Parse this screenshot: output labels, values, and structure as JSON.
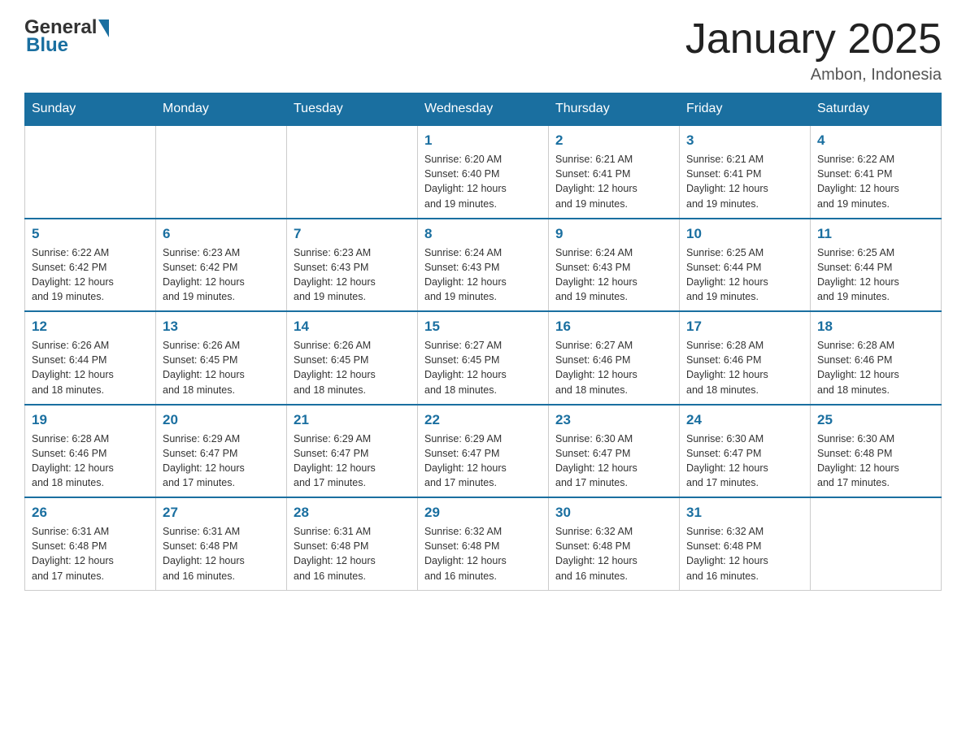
{
  "header": {
    "logo_general": "General",
    "logo_blue": "Blue",
    "month_title": "January 2025",
    "location": "Ambon, Indonesia"
  },
  "days_of_week": [
    "Sunday",
    "Monday",
    "Tuesday",
    "Wednesday",
    "Thursday",
    "Friday",
    "Saturday"
  ],
  "weeks": [
    [
      {
        "day": "",
        "info": ""
      },
      {
        "day": "",
        "info": ""
      },
      {
        "day": "",
        "info": ""
      },
      {
        "day": "1",
        "info": "Sunrise: 6:20 AM\nSunset: 6:40 PM\nDaylight: 12 hours\nand 19 minutes."
      },
      {
        "day": "2",
        "info": "Sunrise: 6:21 AM\nSunset: 6:41 PM\nDaylight: 12 hours\nand 19 minutes."
      },
      {
        "day": "3",
        "info": "Sunrise: 6:21 AM\nSunset: 6:41 PM\nDaylight: 12 hours\nand 19 minutes."
      },
      {
        "day": "4",
        "info": "Sunrise: 6:22 AM\nSunset: 6:41 PM\nDaylight: 12 hours\nand 19 minutes."
      }
    ],
    [
      {
        "day": "5",
        "info": "Sunrise: 6:22 AM\nSunset: 6:42 PM\nDaylight: 12 hours\nand 19 minutes."
      },
      {
        "day": "6",
        "info": "Sunrise: 6:23 AM\nSunset: 6:42 PM\nDaylight: 12 hours\nand 19 minutes."
      },
      {
        "day": "7",
        "info": "Sunrise: 6:23 AM\nSunset: 6:43 PM\nDaylight: 12 hours\nand 19 minutes."
      },
      {
        "day": "8",
        "info": "Sunrise: 6:24 AM\nSunset: 6:43 PM\nDaylight: 12 hours\nand 19 minutes."
      },
      {
        "day": "9",
        "info": "Sunrise: 6:24 AM\nSunset: 6:43 PM\nDaylight: 12 hours\nand 19 minutes."
      },
      {
        "day": "10",
        "info": "Sunrise: 6:25 AM\nSunset: 6:44 PM\nDaylight: 12 hours\nand 19 minutes."
      },
      {
        "day": "11",
        "info": "Sunrise: 6:25 AM\nSunset: 6:44 PM\nDaylight: 12 hours\nand 19 minutes."
      }
    ],
    [
      {
        "day": "12",
        "info": "Sunrise: 6:26 AM\nSunset: 6:44 PM\nDaylight: 12 hours\nand 18 minutes."
      },
      {
        "day": "13",
        "info": "Sunrise: 6:26 AM\nSunset: 6:45 PM\nDaylight: 12 hours\nand 18 minutes."
      },
      {
        "day": "14",
        "info": "Sunrise: 6:26 AM\nSunset: 6:45 PM\nDaylight: 12 hours\nand 18 minutes."
      },
      {
        "day": "15",
        "info": "Sunrise: 6:27 AM\nSunset: 6:45 PM\nDaylight: 12 hours\nand 18 minutes."
      },
      {
        "day": "16",
        "info": "Sunrise: 6:27 AM\nSunset: 6:46 PM\nDaylight: 12 hours\nand 18 minutes."
      },
      {
        "day": "17",
        "info": "Sunrise: 6:28 AM\nSunset: 6:46 PM\nDaylight: 12 hours\nand 18 minutes."
      },
      {
        "day": "18",
        "info": "Sunrise: 6:28 AM\nSunset: 6:46 PM\nDaylight: 12 hours\nand 18 minutes."
      }
    ],
    [
      {
        "day": "19",
        "info": "Sunrise: 6:28 AM\nSunset: 6:46 PM\nDaylight: 12 hours\nand 18 minutes."
      },
      {
        "day": "20",
        "info": "Sunrise: 6:29 AM\nSunset: 6:47 PM\nDaylight: 12 hours\nand 17 minutes."
      },
      {
        "day": "21",
        "info": "Sunrise: 6:29 AM\nSunset: 6:47 PM\nDaylight: 12 hours\nand 17 minutes."
      },
      {
        "day": "22",
        "info": "Sunrise: 6:29 AM\nSunset: 6:47 PM\nDaylight: 12 hours\nand 17 minutes."
      },
      {
        "day": "23",
        "info": "Sunrise: 6:30 AM\nSunset: 6:47 PM\nDaylight: 12 hours\nand 17 minutes."
      },
      {
        "day": "24",
        "info": "Sunrise: 6:30 AM\nSunset: 6:47 PM\nDaylight: 12 hours\nand 17 minutes."
      },
      {
        "day": "25",
        "info": "Sunrise: 6:30 AM\nSunset: 6:48 PM\nDaylight: 12 hours\nand 17 minutes."
      }
    ],
    [
      {
        "day": "26",
        "info": "Sunrise: 6:31 AM\nSunset: 6:48 PM\nDaylight: 12 hours\nand 17 minutes."
      },
      {
        "day": "27",
        "info": "Sunrise: 6:31 AM\nSunset: 6:48 PM\nDaylight: 12 hours\nand 16 minutes."
      },
      {
        "day": "28",
        "info": "Sunrise: 6:31 AM\nSunset: 6:48 PM\nDaylight: 12 hours\nand 16 minutes."
      },
      {
        "day": "29",
        "info": "Sunrise: 6:32 AM\nSunset: 6:48 PM\nDaylight: 12 hours\nand 16 minutes."
      },
      {
        "day": "30",
        "info": "Sunrise: 6:32 AM\nSunset: 6:48 PM\nDaylight: 12 hours\nand 16 minutes."
      },
      {
        "day": "31",
        "info": "Sunrise: 6:32 AM\nSunset: 6:48 PM\nDaylight: 12 hours\nand 16 minutes."
      },
      {
        "day": "",
        "info": ""
      }
    ]
  ]
}
